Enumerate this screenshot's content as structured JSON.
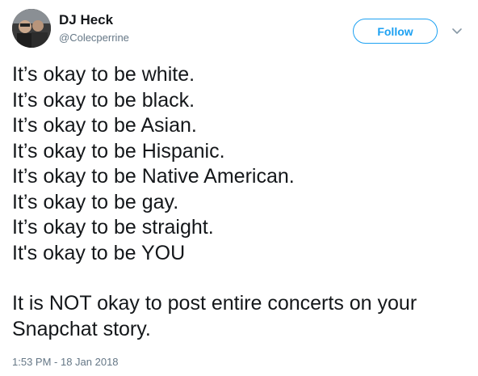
{
  "author": {
    "display_name": "DJ Heck",
    "handle": "@Colecperrine",
    "avatar_icon": "profile-photo"
  },
  "actions": {
    "follow_label": "Follow",
    "menu_icon": "chevron-down-icon"
  },
  "tweet": {
    "lines": [
      "It’s okay to be white.",
      "It’s okay to be black.",
      "It’s okay to be Asian.",
      "It’s okay to be Hispanic.",
      "It’s okay to be Native American.",
      "It’s okay to be gay.",
      "It’s okay to be straight.",
      "It's okay to be YOU"
    ],
    "closing": "It is NOT okay to post entire concerts on your Snapchat story.",
    "timestamp": "1:53 PM - 18 Jan 2018"
  },
  "colors": {
    "accent": "#1da1f2",
    "text": "#14171a",
    "secondary": "#657786"
  }
}
